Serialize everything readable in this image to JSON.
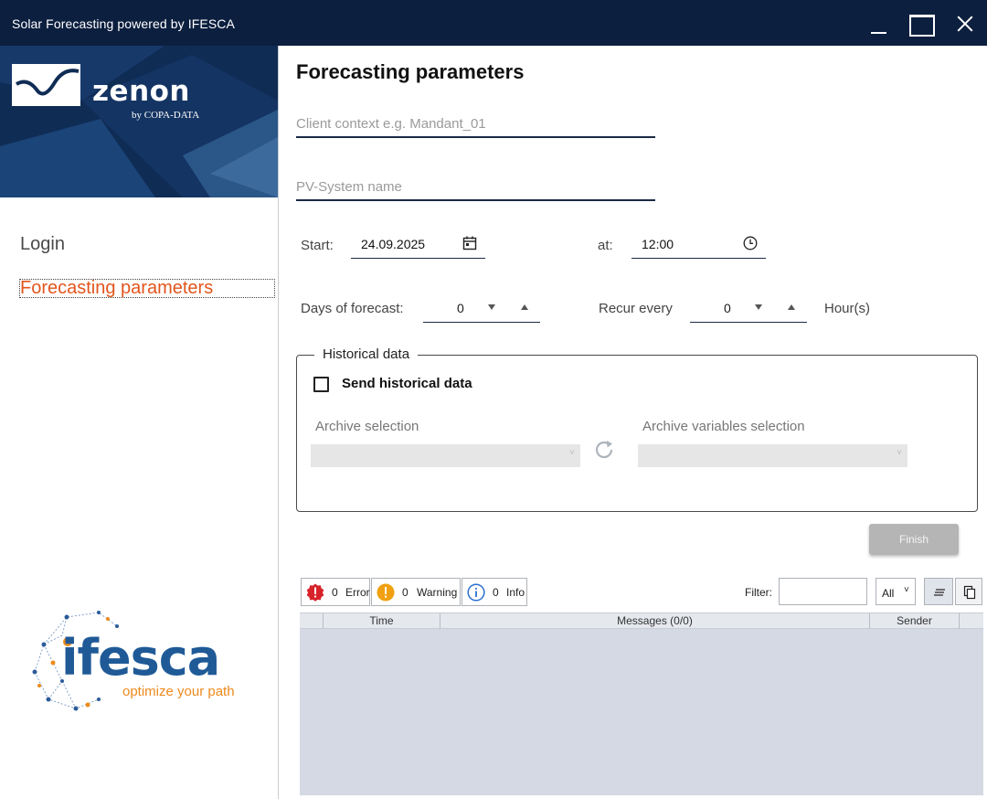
{
  "window": {
    "title": "Solar Forecasting powered by IFESCA"
  },
  "brand": {
    "product": "zenon",
    "vendor": "by COPA-DATA",
    "partner": "ifesca",
    "partner_tagline": "optimize your path"
  },
  "sidebar": {
    "items": [
      {
        "label": "Login"
      },
      {
        "label": "Forecasting parameters",
        "active": true
      }
    ],
    "accent_color": "#e2551d"
  },
  "main": {
    "title": "Forecasting parameters",
    "client_context": {
      "value": "",
      "placeholder": "Client context e.g. Mandant_01"
    },
    "pv_system": {
      "value": "",
      "placeholder": "PV-System name"
    },
    "start": {
      "label": "Start:",
      "date": "24.09.2025",
      "at_label": "at:",
      "time": "12:00"
    },
    "days": {
      "label": "Days of forecast:",
      "value": "0"
    },
    "recur": {
      "label": "Recur every",
      "value": "0",
      "unit": "Hour(s)"
    },
    "historical": {
      "legend": "Historical data",
      "checkbox_label": "Send historical data",
      "checked": false,
      "archive_label": "Archive selection",
      "archive_value": "",
      "variables_label": "Archive variables selection",
      "variables_value": ""
    },
    "finish_label": "Finish"
  },
  "log": {
    "error": {
      "count": "0",
      "label": "Error"
    },
    "warning": {
      "count": "0",
      "label": "Warning"
    },
    "info": {
      "count": "0",
      "label": "Info"
    },
    "filter_label": "Filter:",
    "filter_value": "",
    "filter_select": "All",
    "columns": {
      "time": "Time",
      "messages": "Messages (0/0)",
      "sender": "Sender"
    },
    "rows": []
  },
  "icons": {
    "date": "calendar-icon",
    "time": "clock-icon",
    "refresh": "refresh-icon",
    "error": "error-icon",
    "warning": "warning-icon",
    "info": "info-icon",
    "wrap": "wrap-text-icon",
    "copy": "copy-icon"
  }
}
